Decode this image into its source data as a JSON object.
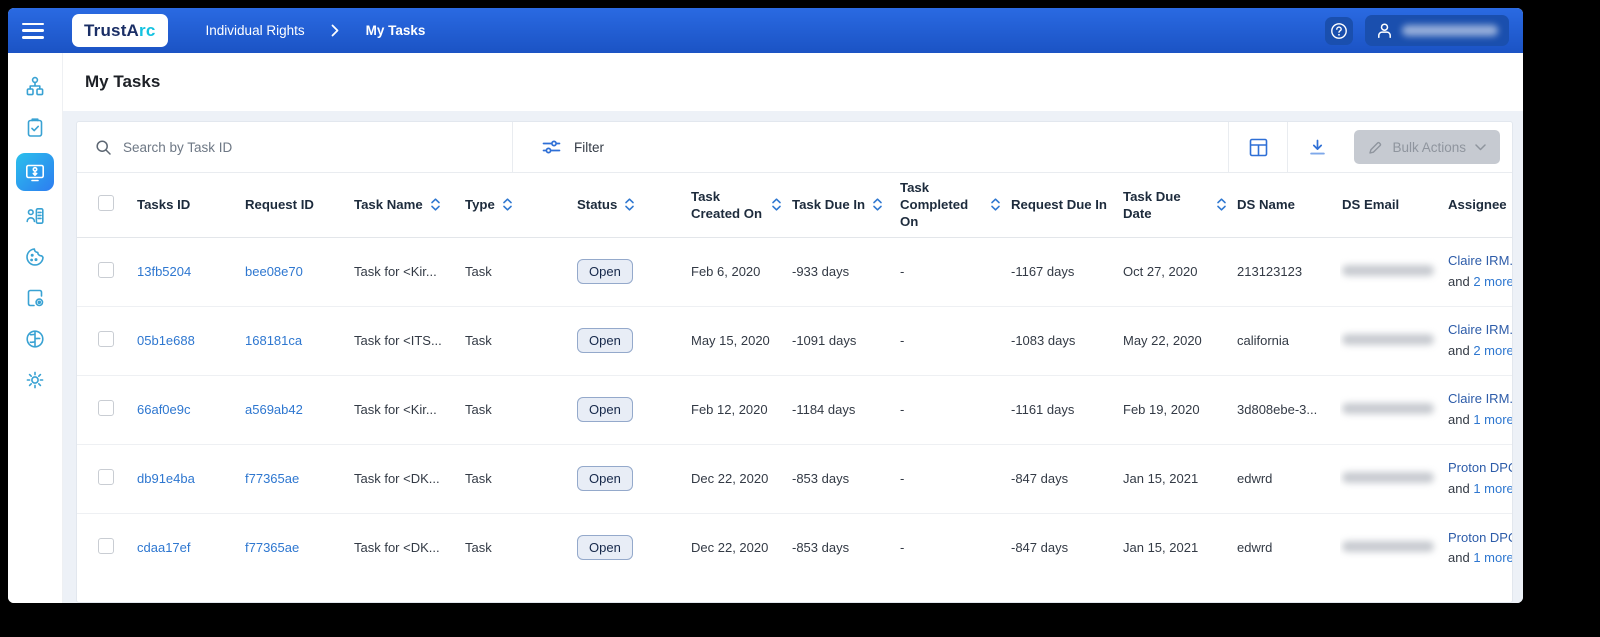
{
  "topbar": {
    "logo": {
      "prefix": "TrustA",
      "suffix": "rc"
    },
    "breadcrumb": {
      "parent": "Individual Rights",
      "current": "My Tasks"
    }
  },
  "page": {
    "title": "My Tasks"
  },
  "toolbar": {
    "search_placeholder": "Search by Task ID",
    "filter_label": "Filter",
    "bulk_actions_label": "Bulk Actions"
  },
  "sidebar": {
    "icons": [
      "hierarchy-icon",
      "clipboard-check-icon",
      "task-assignment-icon",
      "person-record-icon",
      "cookie-icon",
      "document-settings-icon",
      "brain-icon",
      "settings-icon"
    ],
    "active_icon": "task-assignment-icon"
  },
  "table": {
    "columns": [
      {
        "label": "",
        "type": "checkbox",
        "sortable": false
      },
      {
        "label": "Tasks ID",
        "sortable": false
      },
      {
        "label": "Request ID",
        "sortable": false
      },
      {
        "label": "Task Name",
        "sortable": true
      },
      {
        "label": "Type",
        "sortable": true
      },
      {
        "label": "Status",
        "sortable": true
      },
      {
        "label": "Task Created On",
        "sortable": true
      },
      {
        "label": "Task Due In",
        "sortable": true
      },
      {
        "label": "Task Completed On",
        "sortable": true
      },
      {
        "label": "Request Due In",
        "sortable": false
      },
      {
        "label": "Task Due Date",
        "sortable": true
      },
      {
        "label": "DS Name",
        "sortable": false
      },
      {
        "label": "DS Email",
        "sortable": false
      },
      {
        "label": "Assignee",
        "sortable": false
      }
    ],
    "rows": [
      {
        "task_id": "13fb5204",
        "request_id": "bee08e70",
        "task_name": "Task for <Kir...",
        "type": "Task",
        "status": "Open",
        "created_on": "Feb 6, 2020",
        "due_in": "-933 days",
        "completed_on": "-",
        "request_due_in": "-1167 days",
        "due_date": "Oct 27, 2020",
        "ds_name": "213123123",
        "ds_email_blurred": true,
        "assignee": "Claire IRM..",
        "assignee_and": "and",
        "assignee_more": "2 more"
      },
      {
        "task_id": "05b1e688",
        "request_id": "168181ca",
        "task_name": "Task for <ITS...",
        "type": "Task",
        "status": "Open",
        "created_on": "May 15, 2020",
        "due_in": "-1091 days",
        "completed_on": "-",
        "request_due_in": "-1083 days",
        "due_date": "May 22, 2020",
        "ds_name": "california",
        "ds_email_blurred": true,
        "assignee": "Claire IRM..",
        "assignee_and": "and",
        "assignee_more": "2 more"
      },
      {
        "task_id": "66af0e9c",
        "request_id": "a569ab42",
        "task_name": "Task for <Kir...",
        "type": "Task",
        "status": "Open",
        "created_on": "Feb 12, 2020",
        "due_in": "-1184 days",
        "completed_on": "-",
        "request_due_in": "-1161 days",
        "due_date": "Feb 19, 2020",
        "ds_name": "3d808ebe-3...",
        "ds_email_blurred": true,
        "assignee": "Claire IRM..",
        "assignee_and": "and",
        "assignee_more": "1 more"
      },
      {
        "task_id": "db91e4ba",
        "request_id": "f77365ae",
        "task_name": "Task for <DK...",
        "type": "Task",
        "status": "Open",
        "created_on": "Dec 22, 2020",
        "due_in": "-853 days",
        "completed_on": "-",
        "request_due_in": "-847 days",
        "due_date": "Jan 15, 2021",
        "ds_name": "edwrd",
        "ds_email_blurred": true,
        "assignee": "Proton DPO",
        "assignee_and": "and",
        "assignee_more": "1 more"
      },
      {
        "task_id": "cdaa17ef",
        "request_id": "f77365ae",
        "task_name": "Task for <DK...",
        "type": "Task",
        "status": "Open",
        "created_on": "Dec 22, 2020",
        "due_in": "-853 days",
        "completed_on": "-",
        "request_due_in": "-847 days",
        "due_date": "Jan 15, 2021",
        "ds_name": "edwrd",
        "ds_email_blurred": true,
        "assignee": "Proton DPO",
        "assignee_and": "and",
        "assignee_more": "1 more"
      }
    ]
  },
  "colors": {
    "topbar_blue": "#1e5ed8",
    "topbar_button_blue": "#1a4fae",
    "accent_blue": "#2e6fd6",
    "link_blue": "#2e77d0",
    "assignee_navy": "#2d5ca9",
    "active_item_gradient_start": "#2bc0ec",
    "active_item_gradient_end": "#2d7cf0",
    "sidebar_icon_teal": "#39a2d3",
    "badge_bg": "#e8edf6",
    "badge_border": "#94a9cb",
    "badge_text": "#16284a",
    "content_bg": "#edf1f7",
    "logo_navy": "#1b2f66",
    "logo_cyan": "#14c2e0",
    "disabled_button_bg": "#c6cad1"
  }
}
